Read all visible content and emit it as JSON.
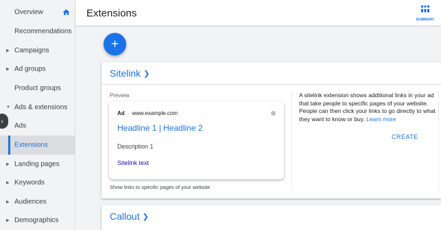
{
  "header": {
    "title": "Extensions",
    "summary_label": "SUMMARY"
  },
  "sidebar": {
    "items": [
      {
        "label": "Overview",
        "has_arrow": false
      },
      {
        "label": "Recommendations",
        "has_arrow": false
      },
      {
        "label": "Campaigns",
        "has_arrow": true
      },
      {
        "label": "Ad groups",
        "has_arrow": true
      },
      {
        "label": "Product groups",
        "has_arrow": false
      },
      {
        "label": "Ads & extensions",
        "has_arrow": true
      },
      {
        "label": "Ads",
        "has_arrow": false
      },
      {
        "label": "Extensions",
        "has_arrow": false
      },
      {
        "label": "Landing pages",
        "has_arrow": true
      },
      {
        "label": "Keywords",
        "has_arrow": true
      },
      {
        "label": "Audiences",
        "has_arrow": true
      },
      {
        "label": "Demographics",
        "has_arrow": true
      }
    ],
    "active_item": "Extensions"
  },
  "fab": {
    "label": "+"
  },
  "sitelink_card": {
    "title": "Sitelink",
    "preview_label": "Preview",
    "ad": {
      "tag": "Ad",
      "separator": "·",
      "url": "www.example.com",
      "headline": "Headline 1 | Headline 2",
      "description": "Description 1",
      "sitelink_text": "Sitelink text"
    },
    "footer": "Show links to specific pages of your website",
    "description": "A sitelink extension shows additional links in your ad that take people to specific pages of your website. People can then click your links to go directly to what they want to know or buy.",
    "learn_more": "Learn more",
    "create_label": "CREATE"
  },
  "callout_card": {
    "title": "Callout"
  },
  "colors": {
    "accent": "#1a73e8",
    "sidebar_bg": "#f1f3f4",
    "active_bg": "#dadce0"
  }
}
